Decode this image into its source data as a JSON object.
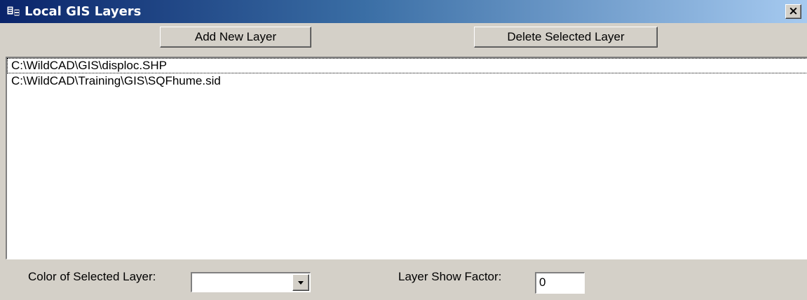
{
  "window": {
    "title": "Local GIS Layers",
    "close_label": "×"
  },
  "toolbar": {
    "add_label": "Add New Layer",
    "delete_label": "Delete Selected Layer"
  },
  "layers": [
    "C:\\WildCAD\\GIS\\disploc.SHP",
    "C:\\WildCAD\\Training\\GIS\\SQFhume.sid"
  ],
  "footer": {
    "color_label": "Color of Selected Layer:",
    "color_value": "",
    "factor_label": "Layer Show Factor:",
    "factor_value": "0"
  },
  "colors": {
    "titlebar_start": "#0a246a",
    "titlebar_end": "#a6caf0",
    "face": "#d4d0c8"
  }
}
